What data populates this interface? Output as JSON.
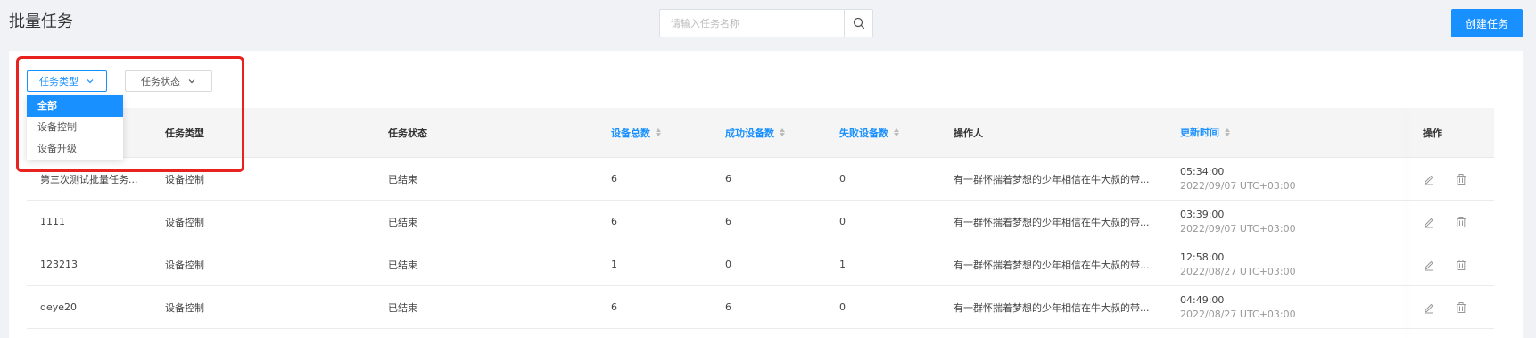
{
  "header": {
    "title": "批量任务",
    "search_placeholder": "请输入任务名称",
    "create_label": "创建任务"
  },
  "filters": {
    "task_type_label": "任务类型",
    "task_status_label": "任务状态"
  },
  "dropdown": {
    "options": [
      "全部",
      "设备控制",
      "设备升级"
    ],
    "selected": "全部"
  },
  "table": {
    "columns": [
      "任务类型",
      "任务状态",
      "设备总数",
      "成功设备数",
      "失败设备数",
      "操作人",
      "更新时间",
      "操作"
    ],
    "rows": [
      {
        "name": "第三次测试批量任务...",
        "type": "设备控制",
        "status": "已结束",
        "total": "6",
        "success": "6",
        "fail": "0",
        "operator": "有一群怀揣着梦想的少年相信在牛大叔的带...",
        "time": "05:34:00",
        "date": "2022/09/07 UTC+03:00"
      },
      {
        "name": "1111",
        "type": "设备控制",
        "status": "已结束",
        "total": "6",
        "success": "6",
        "fail": "0",
        "operator": "有一群怀揣着梦想的少年相信在牛大叔的带...",
        "time": "03:39:00",
        "date": "2022/09/07 UTC+03:00"
      },
      {
        "name": "123213",
        "type": "设备控制",
        "status": "已结束",
        "total": "1",
        "success": "0",
        "fail": "1",
        "operator": "有一群怀揣着梦想的少年相信在牛大叔的带...",
        "time": "12:58:00",
        "date": "2022/08/27 UTC+03:00"
      },
      {
        "name": "deye20",
        "type": "设备控制",
        "status": "已结束",
        "total": "6",
        "success": "6",
        "fail": "0",
        "operator": "有一群怀揣着梦想的少年相信在牛大叔的带...",
        "time": "04:49:00",
        "date": "2022/08/27 UTC+03:00"
      }
    ]
  },
  "colors": {
    "primary": "#1890ff",
    "highlight": "#e8231f",
    "background": "#f0f2f5"
  },
  "icons": {
    "search": "search-icon",
    "chevron": "chevron-down-icon",
    "edit": "edit-icon",
    "delete": "trash-icon"
  }
}
